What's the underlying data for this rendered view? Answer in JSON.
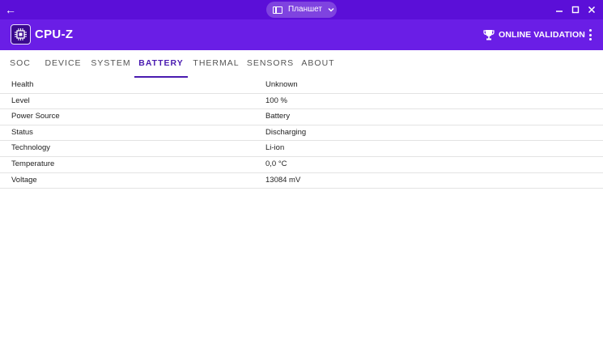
{
  "window": {
    "mode_label": "Планшет"
  },
  "appbar": {
    "title": "CPU-Z",
    "validation_label": "ONLINE VALIDATION"
  },
  "tabs": [
    {
      "label": "SOC"
    },
    {
      "label": "DEVICE"
    },
    {
      "label": "SYSTEM"
    },
    {
      "label": "BATTERY",
      "active": true
    },
    {
      "label": "THERMAL"
    },
    {
      "label": "SENSORS"
    },
    {
      "label": "ABOUT"
    }
  ],
  "battery": {
    "rows": [
      {
        "label": "Health",
        "value": "Unknown"
      },
      {
        "label": "Level",
        "value": "100 %"
      },
      {
        "label": "Power Source",
        "value": "Battery"
      },
      {
        "label": "Status",
        "value": "Discharging"
      },
      {
        "label": "Technology",
        "value": "Li-ion"
      },
      {
        "label": "Temperature",
        "value": "0,0 °C"
      },
      {
        "label": "Voltage",
        "value": "13084 mV"
      }
    ]
  },
  "colors": {
    "caption_bg": "#5b0fd8",
    "appbar_bg": "#6a1ee6",
    "active_tab": "#4a1bb0"
  },
  "icons": {
    "back": "back-arrow-icon",
    "mode": "tablet-icon",
    "minimize": "minimize-icon",
    "maximize": "maximize-icon",
    "close": "close-icon",
    "logo": "cpu-chip-icon",
    "validation": "trophy-icon",
    "menu": "more-vert-icon"
  }
}
